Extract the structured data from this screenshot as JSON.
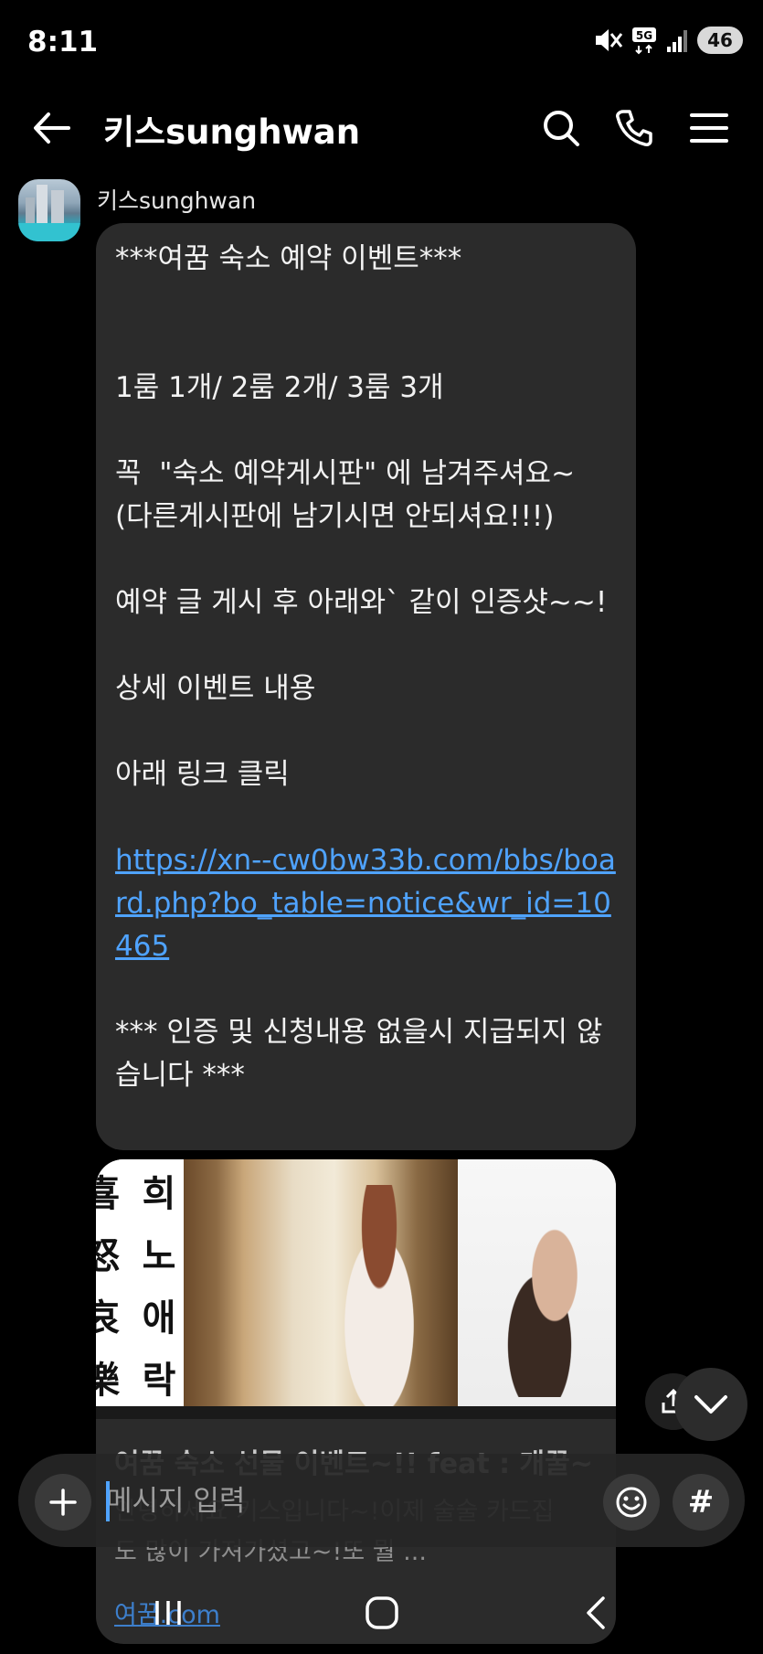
{
  "status_bar": {
    "time": "8:11",
    "network": "5G",
    "battery": "46"
  },
  "header": {
    "title": "키스sunghwan",
    "icons": [
      "back-arrow-icon",
      "search-icon",
      "phone-icon",
      "menu-icon"
    ]
  },
  "message": {
    "sender": "키스sunghwan",
    "text_before_link": "***여꿈 숙소 예약 이벤트***\n\n\n1룸 1개/ 2룸 2개/ 3룸 3개\n\n꼭  \"숙소 예약게시판\" 에 남겨주셔요~\n(다른게시판에 남기시면 안되셔요!!!)\n\n예약 글 게시 후 아래와` 같이 인증샷~~!\n\n상세 이벤트 내용\n\n아래 링크 클릭\n\n",
    "link": "https://xn--cw0bw33b.com/bbs/board.php?bo_table=notice&wr_id=10465",
    "text_after_link": "\n\n*** 인증 및 신청내용 없을시 지급되지 않습니다 ***"
  },
  "link_preview": {
    "image_text_left": "희노애락",
    "image_text_edge": "喜怒哀樂",
    "title": "여꿈 숙소 선물 이벤트~!! feat : 개꿀~",
    "description": "안녕하세요 키스입니다~!이제 술술 카드집도 많이 가져가셨고~!또 뭘 ...",
    "domain": "여꿈.com"
  },
  "composer": {
    "placeholder": "메시지 입력",
    "hashtag_label": "#"
  },
  "colors": {
    "background": "#000000",
    "bubble": "#2b2b2b",
    "link": "#4fa3ff"
  }
}
